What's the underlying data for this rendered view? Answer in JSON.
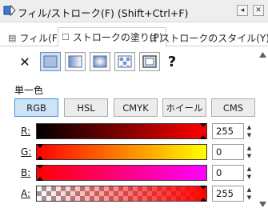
{
  "window": {
    "title": "フィル/ストローク(F) (Shift+Ctrl+F)",
    "dock_icon": "dock-icon",
    "close_icon": "close-icon"
  },
  "tabs": [
    {
      "label": "フィル(F)",
      "icon": "fill-tab-icon",
      "active": false
    },
    {
      "label": "ストロークの塗り(P)",
      "icon": "stroke-paint-tab-icon",
      "active": true
    },
    {
      "label": "ストロークのスタイル(Y)",
      "icon": "stroke-style-tab-icon",
      "active": false
    }
  ],
  "paint_types": [
    {
      "name": "no-paint",
      "glyph": "✕"
    },
    {
      "name": "flat-color",
      "selected": true
    },
    {
      "name": "linear-gradient"
    },
    {
      "name": "radial-gradient"
    },
    {
      "name": "pattern"
    },
    {
      "name": "swatch"
    },
    {
      "name": "unset",
      "glyph": "?"
    }
  ],
  "section_label": "単一色",
  "color_modes": [
    {
      "label": "RGB",
      "selected": true
    },
    {
      "label": "HSL",
      "selected": false
    },
    {
      "label": "CMYK",
      "selected": false
    },
    {
      "label": "ホイール",
      "selected": false
    },
    {
      "label": "CMS",
      "selected": false
    }
  ],
  "channels": [
    {
      "label": "R:",
      "value": "255",
      "level": 1.0,
      "gradient": "linear-gradient(to right, #000000, #ff0000)"
    },
    {
      "label": "G:",
      "value": "0",
      "level": 0.0,
      "gradient": "linear-gradient(to right, #ff0000, #ffff00)"
    },
    {
      "label": "B:",
      "value": "0",
      "level": 0.0,
      "gradient": "linear-gradient(to right, #ff0000, #ff00ff)"
    },
    {
      "label": "A:",
      "value": "255",
      "level": 1.0,
      "gradient": "linear-gradient(to right, rgba(255,0,0,0), #ff0000)"
    }
  ],
  "colors": {
    "accent": "#ff0000",
    "selected_bg": "#cde4f7",
    "selected_border": "#4a90d9"
  }
}
